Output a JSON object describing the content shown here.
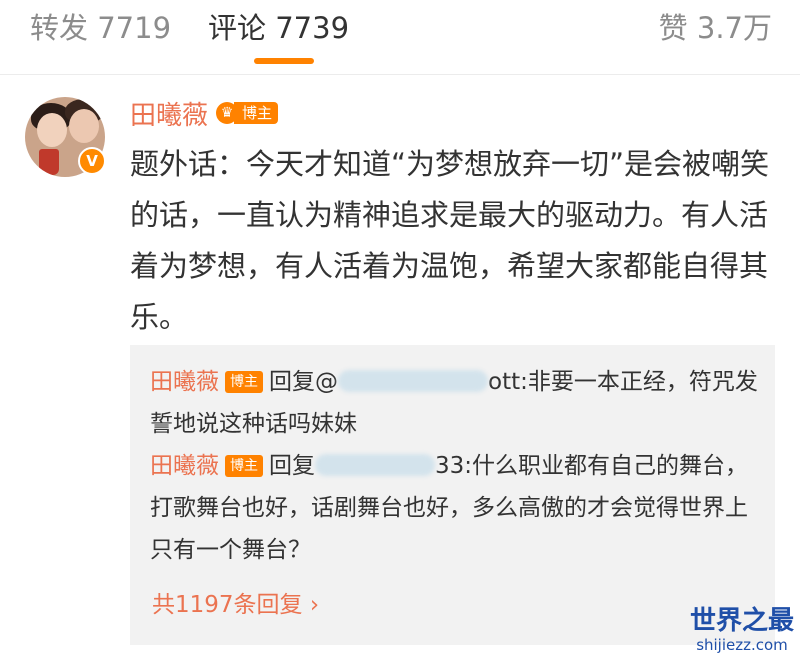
{
  "tabs": {
    "repost": "转发 7719",
    "comment": "评论 7739",
    "like": "赞 3.7万"
  },
  "comment": {
    "author": "田曦薇",
    "badge_label": "博主",
    "text": "题外话：今天才知道“为梦想放弃一切”是会被嘲笑的话，一直认为精神追求是最大的驱动力。有人活着为梦想，有人活着为温饱，希望大家都能自得其乐。"
  },
  "replies": [
    {
      "author": "田曦薇",
      "badge_label": "博主",
      "prefix": "回复@",
      "suffix": "ott:非要一本正经，符咒发誓地说这种话吗妹妹"
    },
    {
      "author": "田曦薇",
      "badge_label": "博主",
      "prefix": "回复",
      "suffix": "33:什么职业都有自己的舞台，打歌舞台也好，话剧舞台也好，多么高傲的才会觉得世界上只有一个舞台？"
    }
  ],
  "reply_count": "共1197条回复 ›",
  "watermark": {
    "title": "世界之最",
    "domain": "shijiezz.com"
  },
  "colors": {
    "accent": "#ff8200",
    "name": "#eb7350",
    "reply_bg": "#f2f2f2"
  },
  "icons": {
    "crown": "crown-icon",
    "verified": "verified-v-icon",
    "chevron": "chevron-right-icon"
  }
}
